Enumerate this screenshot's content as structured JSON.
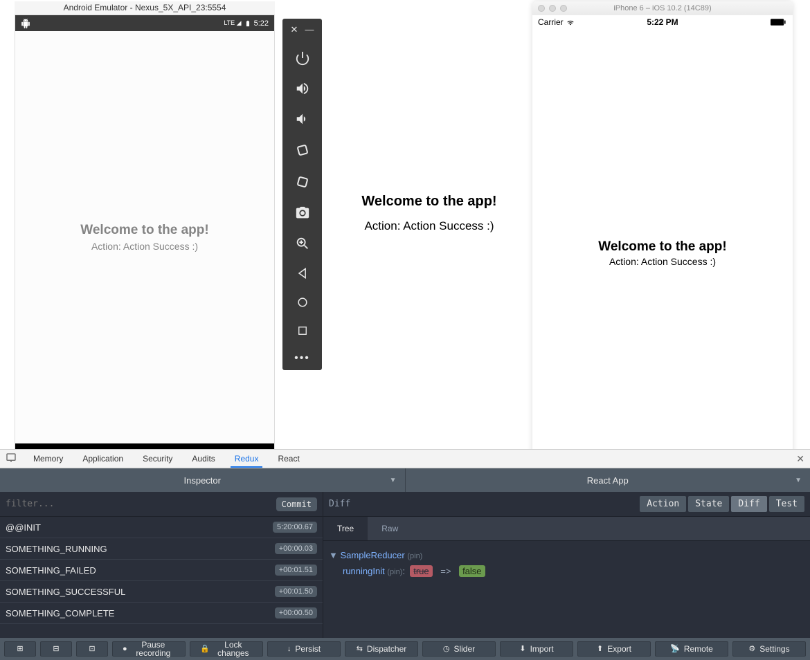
{
  "android": {
    "title": "Android Emulator - Nexus_5X_API_23:5554",
    "status_time": "5:22",
    "welcome_heading": "Welcome to the app!",
    "action_text": "Action: Action Success :)"
  },
  "emulator_toolbar_icons": [
    "close",
    "minimize",
    "power",
    "volume-up",
    "volume-down",
    "rotate-left",
    "rotate-right",
    "camera",
    "zoom",
    "back",
    "home",
    "overview",
    "more"
  ],
  "center": {
    "welcome_heading": "Welcome to the app!",
    "action_text": "Action: Action Success :)"
  },
  "ios": {
    "title": "iPhone 6 – iOS 10.2 (14C89)",
    "carrier": "Carrier",
    "status_time": "5:22 PM",
    "welcome_heading": "Welcome to the app!",
    "action_text": "Action: Action Success :)"
  },
  "devtools_tabs": {
    "items": [
      "Memory",
      "Application",
      "Security",
      "Audits",
      "Redux",
      "React"
    ],
    "active": "Redux"
  },
  "redux_header": {
    "left": "Inspector",
    "right": "React App"
  },
  "redux_filter": {
    "placeholder": "filter...",
    "commit_label": "Commit"
  },
  "redux_actions": [
    {
      "name": "@@INIT",
      "time": "5:20:00.67"
    },
    {
      "name": "SOMETHING_RUNNING",
      "time": "+00:00.03"
    },
    {
      "name": "SOMETHING_FAILED",
      "time": "+00:01.51"
    },
    {
      "name": "SOMETHING_SUCCESSFUL",
      "time": "+00:01.50"
    },
    {
      "name": "SOMETHING_COMPLETE",
      "time": "+00:00.50"
    }
  ],
  "redux_right": {
    "title": "Diff",
    "tabs": [
      "Action",
      "State",
      "Diff",
      "Test"
    ],
    "active_tab": "Diff",
    "subtabs": [
      "Tree",
      "Raw"
    ],
    "active_subtab": "Tree",
    "tree": {
      "reducer": "SampleReducer",
      "pin_label": "(pin)",
      "key": "runningInit",
      "old_value": "true",
      "arrow": "=>",
      "new_value": "false"
    }
  },
  "bottom_bar": {
    "buttons": [
      {
        "icon": "⊞",
        "label": ""
      },
      {
        "icon": "⊟",
        "label": ""
      },
      {
        "icon": "⊡",
        "label": ""
      },
      {
        "icon": "●",
        "label": "Pause recording"
      },
      {
        "icon": "🔒",
        "label": "Lock changes"
      },
      {
        "icon": "↓",
        "label": "Persist"
      },
      {
        "icon": "⇆",
        "label": "Dispatcher"
      },
      {
        "icon": "◷",
        "label": "Slider"
      },
      {
        "icon": "⬇",
        "label": "Import"
      },
      {
        "icon": "⬆",
        "label": "Export"
      },
      {
        "icon": "📡",
        "label": "Remote"
      },
      {
        "icon": "⚙",
        "label": "Settings"
      }
    ]
  }
}
